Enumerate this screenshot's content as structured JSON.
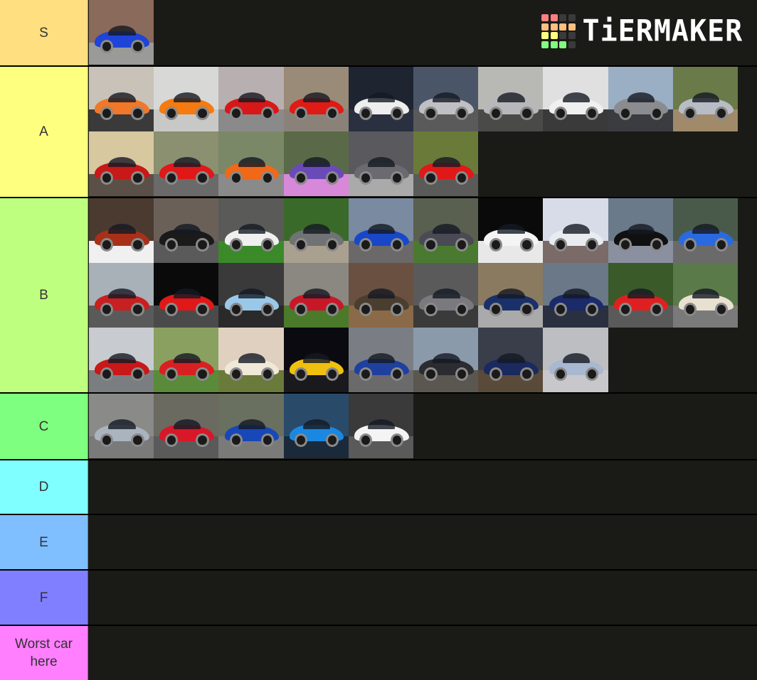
{
  "app": {
    "title": "TierMaker",
    "logo_text": "TiERMAKER",
    "logo_grid_colors": [
      "#ff7f7f",
      "#ff7f7f",
      "#3a3a3a",
      "#3a3a3a",
      "#ffbf7f",
      "#ffbf7f",
      "#ffbf7f",
      "#ffbf7f",
      "#ffff7f",
      "#ffff7f",
      "#3a3a3a",
      "#3a3a3a",
      "#7fff7f",
      "#7fff7f",
      "#7fff7f",
      "#3a3a3a"
    ]
  },
  "tiers": [
    {
      "label": "S",
      "color": "#ffdf80",
      "cars": [
        {
          "desc": "blue and black hypercar",
          "bg": "#8a6a5a",
          "ground": "#9a9a98",
          "body": "#1e44d8"
        }
      ]
    },
    {
      "label": "A",
      "color": "#ffff7f",
      "cars": [
        {
          "desc": "gulf livery supercar",
          "bg": "#c8c2b8",
          "ground": "#3a3a3a",
          "body": "#f07828"
        },
        {
          "desc": "orange wedge sports car",
          "bg": "#d8d8d6",
          "ground": "#c8c8c6",
          "body": "#f57a10"
        },
        {
          "desc": "red hypercar",
          "bg": "#b8b0b0",
          "ground": "#8a8a8a",
          "body": "#d81818"
        },
        {
          "desc": "red classic supercar",
          "bg": "#9a8a78",
          "ground": "#8a8278",
          "body": "#e01a14"
        },
        {
          "desc": "white sports car",
          "bg": "#1e2430",
          "ground": "#2a3040",
          "body": "#eeeeee"
        },
        {
          "desc": "silver GT race car",
          "bg": "#4a5668",
          "ground": "#5a5a5a",
          "body": "#c0c0c4"
        },
        {
          "desc": "silver supercar",
          "bg": "#b8b8b4",
          "ground": "#4a4a48",
          "body": "#b8b8bc"
        },
        {
          "desc": "white supercar",
          "bg": "#e0e0e0",
          "ground": "#3a3a3a",
          "body": "#f0f0f0"
        },
        {
          "desc": "silver track car",
          "bg": "#9aaec4",
          "ground": "#3a3c40",
          "body": "#8a8c90"
        },
        {
          "desc": "silver classic hypercar",
          "bg": "#6a7a48",
          "ground": "#a08a6a",
          "body": "#b8bcc4"
        },
        {
          "desc": "red wedge supercar",
          "bg": "#d8c8a0",
          "ground": "#5a5048",
          "body": "#c81818"
        },
        {
          "desc": "red modern supercar",
          "bg": "#8a9070",
          "ground": "#6a6a6a",
          "body": "#e01818"
        },
        {
          "desc": "orange muscle car",
          "bg": "#7a8868",
          "ground": "#8a8a8a",
          "body": "#f06818"
        },
        {
          "desc": "purple wrapped sports car",
          "bg": "#5a6a48",
          "ground": "#d888d8",
          "body": "#6a4ab8"
        },
        {
          "desc": "grey roadster hypercar",
          "bg": "#5a5a5e",
          "ground": "#aaaaaa",
          "body": "#6a6a70"
        },
        {
          "desc": "red hypercar",
          "bg": "#6a7a38",
          "ground": "#5a5a58",
          "body": "#e01818"
        }
      ]
    },
    {
      "label": "B",
      "color": "#bfff7f",
      "cars": [
        {
          "desc": "red grand tourer",
          "bg": "#4a3a30",
          "ground": "#f0f0f0",
          "body": "#a83018"
        },
        {
          "desc": "black race car",
          "bg": "#6a6058",
          "ground": "#5a5a5a",
          "body": "#1a1a1a"
        },
        {
          "desc": "rally livery sports car",
          "bg": "#5a5a58",
          "ground": "#3a8a2a",
          "body": "#f0f0f0"
        },
        {
          "desc": "grey sedan",
          "bg": "#3a6a2a",
          "ground": "#aaa090",
          "body": "#707274"
        },
        {
          "desc": "blue muscle car",
          "bg": "#7a8aa0",
          "ground": "#6a6868",
          "body": "#1848c8"
        },
        {
          "desc": "dark grey luxury sedan",
          "bg": "#5a6050",
          "ground": "#4a7a30",
          "body": "#4a4a54"
        },
        {
          "desc": "white SUV",
          "bg": "#0a0a0a",
          "ground": "#e8e8e8",
          "body": "#f4f4f4"
        },
        {
          "desc": "white sport sedan",
          "bg": "#d8dce8",
          "ground": "#7a6a68",
          "body": "#e8ecf0"
        },
        {
          "desc": "black hypercar",
          "bg": "#6a7a8a",
          "ground": "#8a90a0",
          "body": "#101010"
        },
        {
          "desc": "blue classic hypercar",
          "bg": "#4a5a4a",
          "ground": "#6a6a6a",
          "body": "#2a6ae0"
        },
        {
          "desc": "red classic sports car",
          "bg": "#a8b0b8",
          "ground": "#5a5a5a",
          "body": "#c82020"
        },
        {
          "desc": "red supercar",
          "bg": "#0a0a0a",
          "ground": "#4a4a4a",
          "body": "#e01818"
        },
        {
          "desc": "light blue roadster",
          "bg": "#3a3a3a",
          "ground": "#2a2a2a",
          "body": "#9ac8e8"
        },
        {
          "desc": "red sports car",
          "bg": "#8a8880",
          "ground": "#4a7a2a",
          "body": "#c81828"
        },
        {
          "desc": "brown off-roader",
          "bg": "#6a5040",
          "ground": "#8a6a48",
          "body": "#4a3e30"
        },
        {
          "desc": "grey supercar",
          "bg": "#5a5a5a",
          "ground": "#3a3a3a",
          "body": "#7a7a7e"
        },
        {
          "desc": "dark blue supercar",
          "bg": "#8a7a60",
          "ground": "#aaaaaa",
          "body": "#1a3068"
        },
        {
          "desc": "blue race car",
          "bg": "#6a7888",
          "ground": "#2a3040",
          "body": "#1a2a6a"
        },
        {
          "desc": "red off-roader",
          "bg": "#3a5a2a",
          "ground": "#5a5a5a",
          "body": "#e02020"
        },
        {
          "desc": "jurassic park jeep",
          "bg": "#5a7a4a",
          "ground": "#7a7a7a",
          "body": "#e8e0d0"
        },
        {
          "desc": "red muscle car",
          "bg": "#c8ccd0",
          "ground": "#7a7e80",
          "body": "#c81818"
        },
        {
          "desc": "red coupe",
          "bg": "#8aa060",
          "ground": "#5a8a3a",
          "body": "#d82020"
        },
        {
          "desc": "cream classic coupe",
          "bg": "#e0d0c0",
          "ground": "#6a7a3a",
          "body": "#f0e8d8"
        },
        {
          "desc": "yellow sports car",
          "bg": "#0a0a10",
          "ground": "#1a1a1e",
          "body": "#f0c010"
        },
        {
          "desc": "blue japanese sports car",
          "bg": "#7a7e84",
          "ground": "#6a6a6a",
          "body": "#2040a0"
        },
        {
          "desc": "black pickup truck",
          "bg": "#8a9aaa",
          "ground": "#5a5650",
          "body": "#2a2c30"
        },
        {
          "desc": "dark blue coupe",
          "bg": "#3a3e4a",
          "ground": "#5a4a3a",
          "body": "#1a2a60"
        },
        {
          "desc": "silver-blue sedan",
          "bg": "#bcbec2",
          "ground": "#c8c8cc",
          "body": "#a8b8d0"
        }
      ]
    },
    {
      "label": "C",
      "color": "#7fff7f",
      "cars": [
        {
          "desc": "silver hatchback",
          "bg": "#8a8a88",
          "ground": "#7a7a7a",
          "body": "#aab4be"
        },
        {
          "desc": "red sports coupe",
          "bg": "#6a6a60",
          "ground": "#5a5a5a",
          "body": "#d81828"
        },
        {
          "desc": "blue rally sedan",
          "bg": "#6a7060",
          "ground": "#7a7a78",
          "body": "#1848b8"
        },
        {
          "desc": "blue sports car",
          "bg": "#2a4a6a",
          "ground": "#1a2a3a",
          "body": "#1a88e0"
        },
        {
          "desc": "white japanese coupe",
          "bg": "#3a3a3a",
          "ground": "#5a5a5a",
          "body": "#f4f4f4"
        }
      ]
    },
    {
      "label": "D",
      "color": "#7fffff",
      "cars": []
    },
    {
      "label": "E",
      "color": "#7fbfff",
      "cars": []
    },
    {
      "label": "F",
      "color": "#7f7fff",
      "cars": []
    },
    {
      "label": "Worst car here",
      "color": "#ff7fff",
      "cars": []
    }
  ]
}
